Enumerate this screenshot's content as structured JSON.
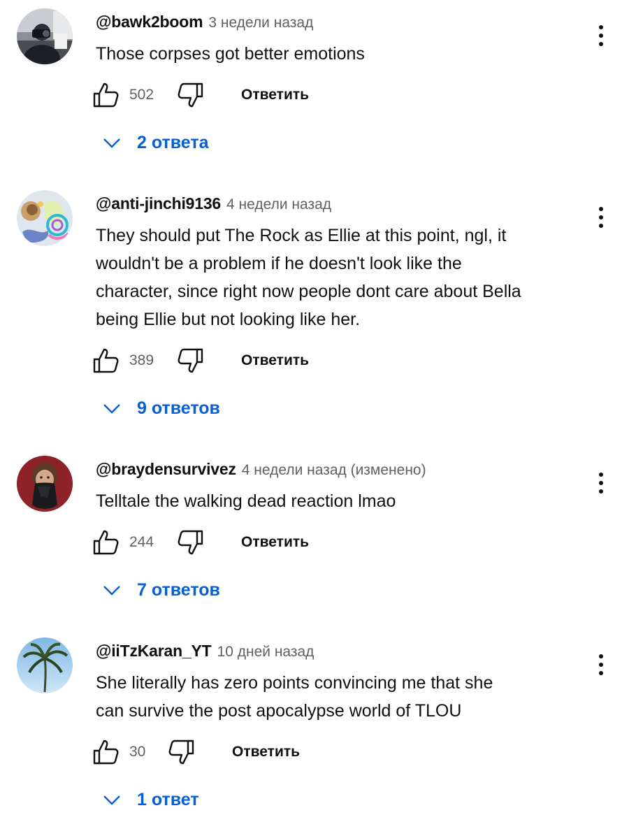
{
  "comments": [
    {
      "author": "@bawk2boom",
      "time": "3 недели назад",
      "text": "Those corpses got better emotions",
      "likes": "502",
      "reply_label": "Ответить",
      "replies": "2 ответа",
      "avatar": "avatar-photographer"
    },
    {
      "author": "@anti-jinchi9136",
      "time": "4 недели назад",
      "text": "They should put The Rock as Ellie at this point, ngl, it\nwouldn't be a problem if he doesn't look like the\ncharacter, since right now people dont care about Bella\nbeing Ellie but not looking like her.",
      "likes": "389",
      "reply_label": "Ответить",
      "replies": "9 ответов",
      "avatar": "avatar-colorful-art"
    },
    {
      "author": "@braydensurvivez",
      "time": "4 недели назад (изменено)",
      "text": "Telltale the walking dead reaction lmao",
      "likes": "244",
      "reply_label": "Ответить",
      "replies": "7 ответов",
      "avatar": "avatar-masked-person"
    },
    {
      "author": "@iiTzKaran_YT",
      "time": "10 дней назад",
      "text": "She literally has zero points convincing me that she\ncan survive the post apocalypse world of TLOU",
      "likes": "30",
      "reply_label": "Ответить",
      "replies": "1 ответ",
      "avatar": "avatar-palm-tree"
    }
  ],
  "icons": {
    "like": "thumb-up-icon",
    "dislike": "thumb-down-icon",
    "more": "more-vertical-icon",
    "expand": "chevron-down-icon"
  },
  "colors": {
    "text": "#0f0f0f",
    "secondary": "#606060",
    "link": "#065fd4"
  }
}
